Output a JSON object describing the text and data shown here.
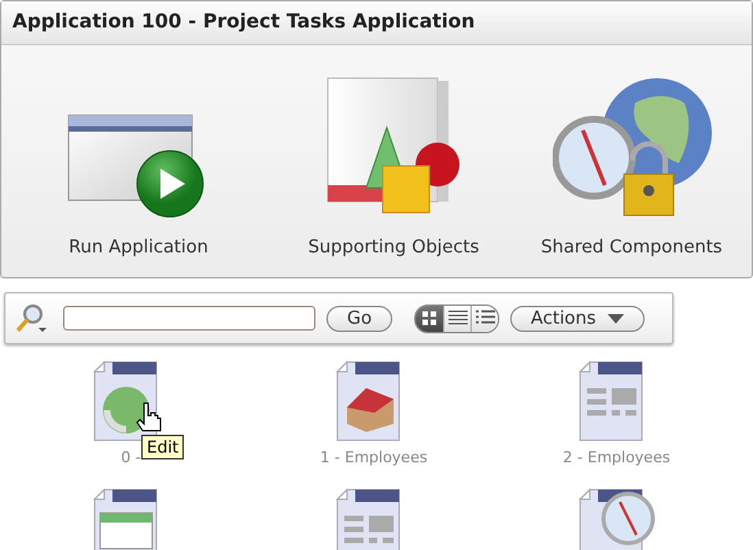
{
  "header": {
    "title": "Application 100 - Project Tasks Application"
  },
  "shortcuts": [
    {
      "kind": "run",
      "label": "Run Application"
    },
    {
      "kind": "objects",
      "label": "Supporting Objects"
    },
    {
      "kind": "shared",
      "label": "Shared Components"
    }
  ],
  "toolbar": {
    "go": "Go",
    "views": [
      {
        "kind": "icons",
        "selected": true
      },
      {
        "kind": "report",
        "selected": false
      },
      {
        "kind": "details",
        "selected": false
      }
    ],
    "actions": "Actions"
  },
  "pages": [
    {
      "kind": "globe",
      "label": "0 -"
    },
    {
      "kind": "house",
      "label": "1 - Employees"
    },
    {
      "kind": "form",
      "label": "2 - Employees"
    },
    {
      "kind": "calendar"
    },
    {
      "kind": "form"
    },
    {
      "kind": "compass"
    }
  ],
  "tooltip": {
    "text": "Edit"
  }
}
